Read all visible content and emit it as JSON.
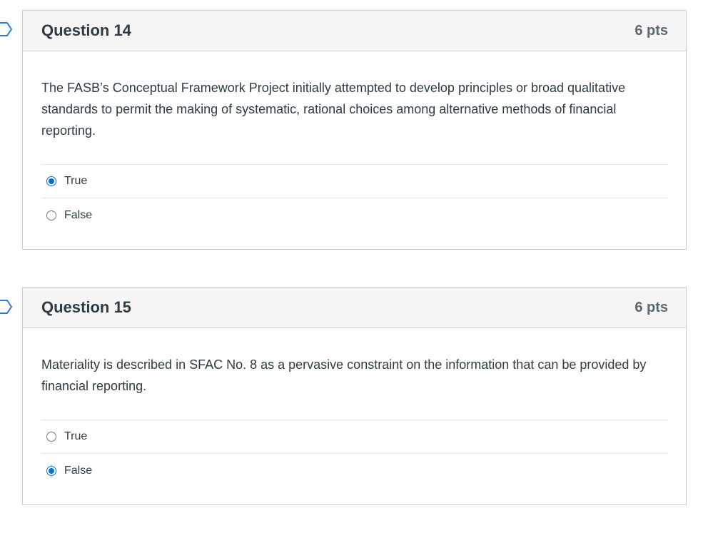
{
  "questions": [
    {
      "title": "Question 14",
      "points": "6 pts",
      "text": "The FASB’s Conceptual Framework Project initially attempted to develop principles or broad qualitative standards to permit the making of systematic, rational choices among alternative methods of financial reporting.",
      "answers": [
        {
          "label": "True",
          "selected": true
        },
        {
          "label": "False",
          "selected": false
        }
      ]
    },
    {
      "title": "Question 15",
      "points": "6 pts",
      "text": "Materiality is described in SFAC No. 8 as a pervasive constraint on the information that can be provided by financial reporting.",
      "answers": [
        {
          "label": "True",
          "selected": false
        },
        {
          "label": "False",
          "selected": true
        }
      ]
    }
  ],
  "colors": {
    "accent": "#0770d6",
    "header_bg": "#f5f5f5",
    "border": "#c7cdd1",
    "text": "#2d3b45"
  },
  "icons": {
    "flag": "bookmark-flag-icon"
  }
}
